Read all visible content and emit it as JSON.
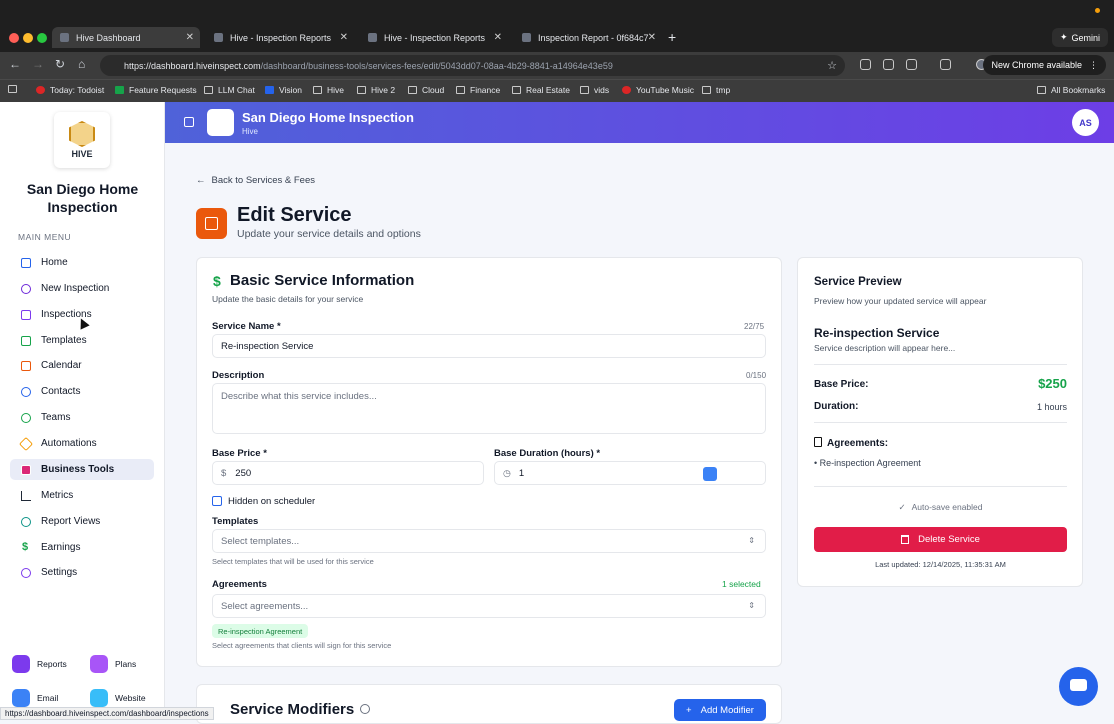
{
  "browser": {
    "tabs": [
      {
        "label": "Hive Dashboard",
        "active": true
      },
      {
        "label": "Hive - Inspection Reports",
        "active": false
      },
      {
        "label": "Hive - Inspection Reports",
        "active": false
      },
      {
        "label": "Inspection Report - 0f684c7",
        "active": false
      }
    ],
    "gemini_label": "Gemini",
    "url_host": "https://dashboard.hiveinspect.com",
    "url_path": "/dashboard/business-tools/services-fees/edit/5043dd07-08aa-4b29-8841-a14964e43e59",
    "new_chrome_label": "New Chrome available",
    "bookmarks": [
      "Today: Todoist",
      "Feature Requests",
      "LLM Chat",
      "Vision",
      "Hive",
      "Hive 2",
      "Cloud",
      "Finance",
      "Real Estate",
      "vids",
      "YouTube Music",
      "tmp"
    ],
    "all_bookmarks_label": "All Bookmarks",
    "status_url": "https://dashboard.hiveinspect.com/dashboard/inspections"
  },
  "sidebar": {
    "logo_text": "HIVE",
    "org_name_line1": "San Diego Home",
    "org_name_line2": "Inspection",
    "section_label": "MAIN MENU",
    "items": [
      {
        "label": "Home",
        "icon": "home-icon",
        "color": "#2563eb"
      },
      {
        "label": "New Inspection",
        "icon": "plus-icon",
        "color": "#6d28d9"
      },
      {
        "label": "Inspections",
        "icon": "clipboard-icon",
        "color": "#7c3aed"
      },
      {
        "label": "Templates",
        "icon": "file-icon",
        "color": "#16a34a"
      },
      {
        "label": "Calendar",
        "icon": "calendar-icon",
        "color": "#ea580c"
      },
      {
        "label": "Contacts",
        "icon": "users-icon",
        "color": "#2563eb"
      },
      {
        "label": "Teams",
        "icon": "team-icon",
        "color": "#16a34a"
      },
      {
        "label": "Automations",
        "icon": "bolt-icon",
        "color": "#f59e0b"
      },
      {
        "label": "Business Tools",
        "icon": "briefcase-icon",
        "color": "#db2777"
      },
      {
        "label": "Metrics",
        "icon": "bar-chart-icon",
        "color": "#1f2937"
      },
      {
        "label": "Report Views",
        "icon": "eye-icon",
        "color": "#0d9488"
      },
      {
        "label": "Earnings",
        "icon": "dollar-icon",
        "color": "#16a34a"
      },
      {
        "label": "Settings",
        "icon": "gear-icon",
        "color": "#7c3aed"
      }
    ],
    "active_item": "Business Tools",
    "bottom_tiles": [
      {
        "label": "Reports",
        "color": "#7c3aed"
      },
      {
        "label": "Plans",
        "color": "#a855f7"
      },
      {
        "label": "Email",
        "color": "#3b82f6"
      },
      {
        "label": "Website",
        "color": "#38bdf8"
      }
    ]
  },
  "header": {
    "title": "San Diego Home Inspection",
    "subtitle": "Hive",
    "avatar_initials": "AS"
  },
  "main": {
    "back_label": "Back to Services & Fees",
    "title": "Edit Service",
    "subtitle": "Update your service details and options",
    "basic": {
      "title": "Basic Service Information",
      "subtitle": "Update the basic details for your service",
      "service_name_label": "Service Name *",
      "service_name_count": "22/75",
      "service_name_value": "Re-inspection Service",
      "description_label": "Description",
      "description_count": "0/150",
      "description_placeholder": "Describe what this service includes...",
      "base_price_label": "Base Price *",
      "base_price_prefix": "$",
      "base_price_value": "250",
      "base_duration_label": "Base Duration (hours) *",
      "base_duration_value": "1",
      "hidden_label": "Hidden on scheduler",
      "hidden_checked": false,
      "templates_label": "Templates",
      "templates_placeholder": "Select templates...",
      "templates_help": "Select templates that will be used for this service",
      "agreements_label": "Agreements",
      "agreements_count": "1 selected",
      "agreements_placeholder": "Select agreements...",
      "agreement_badge": "Re-inspection Agreement",
      "agreements_help": "Select agreements that clients will sign for this service"
    },
    "modifiers": {
      "title": "Service Modifiers",
      "add_label": "Add Modifier"
    }
  },
  "preview": {
    "title": "Service Preview",
    "subtitle": "Preview how your updated service will appear",
    "service_name": "Re-inspection Service",
    "description": "Service description will appear here...",
    "base_price_label": "Base Price:",
    "base_price_value": "$250",
    "duration_label": "Duration:",
    "duration_value": "1 hours",
    "agreements_label": "Agreements:",
    "agreement_item": "• Re-inspection Agreement",
    "autosave": "Auto-save enabled",
    "delete_label": "Delete Service",
    "last_updated": "Last updated: 12/14/2025, 11:35:31 AM"
  }
}
